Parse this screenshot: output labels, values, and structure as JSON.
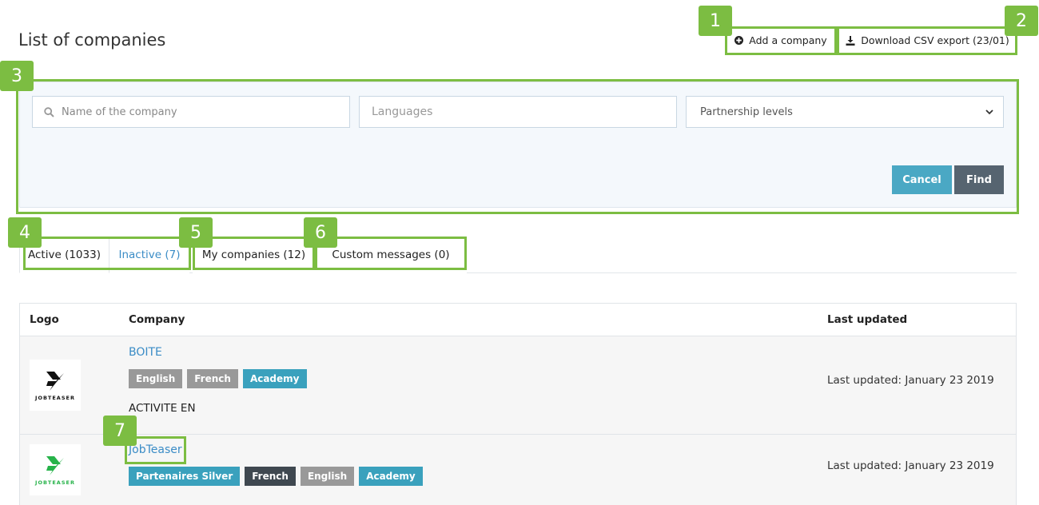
{
  "page": {
    "title": "List of companies"
  },
  "toolbar": {
    "add_label": "Add a company",
    "add_icon": "plus-circle-icon",
    "csv_label": "Download CSV export (23/01)",
    "csv_icon": "download-icon"
  },
  "search": {
    "name_placeholder": "Name of the company",
    "languages_placeholder": "Languages",
    "partnership_label": "Partnership levels",
    "cancel_label": "Cancel",
    "find_label": "Find"
  },
  "tabs": [
    {
      "label": "Active (1033)"
    },
    {
      "label": "Inactive (7)"
    },
    {
      "label": "My companies (12)"
    },
    {
      "label": "Custom messages (0)"
    }
  ],
  "table": {
    "headers": {
      "logo": "Logo",
      "company": "Company",
      "updated": "Last updated"
    },
    "rows": [
      {
        "logo_text": "JOBTEASER",
        "logo_color": "#111111",
        "name": "BOITE",
        "tags": [
          "English",
          "French",
          "Academy"
        ],
        "activity": "ACTIVITE EN",
        "updated": "Last updated: January 23 2019"
      },
      {
        "logo_text": "JOBTEASER",
        "logo_color": "#27b34a",
        "name": "JobTeaser",
        "tags": [
          "Partenaires Silver",
          "French",
          "English",
          "Academy"
        ],
        "updated": "Last updated: January 23 2019"
      }
    ]
  },
  "callouts": [
    "1",
    "2",
    "3",
    "4",
    "5",
    "6",
    "7"
  ],
  "colors": {
    "callout": "#7cbd42",
    "link": "#3a8cc6",
    "cancel": "#4aa8c4",
    "find": "#566470"
  }
}
